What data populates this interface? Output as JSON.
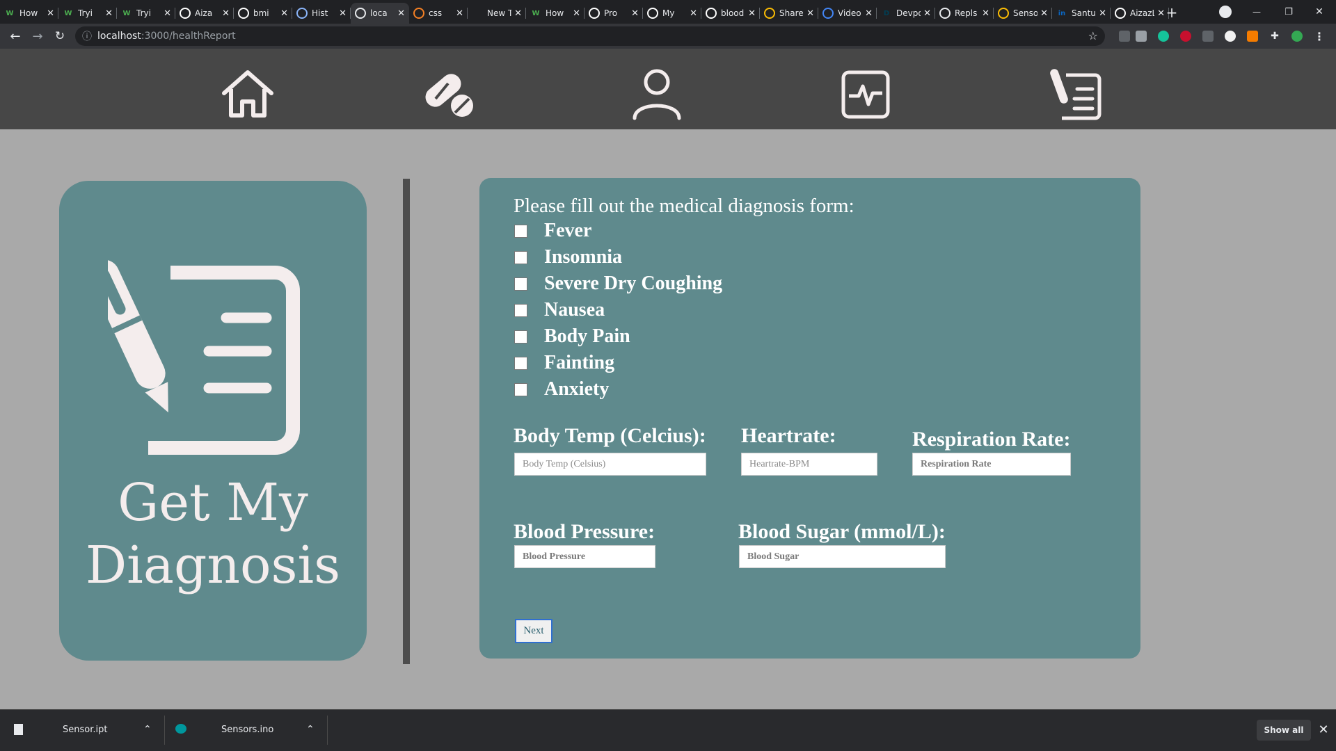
{
  "browser": {
    "tabs": [
      {
        "title": "How",
        "favicon": "W",
        "color": "#4caf50"
      },
      {
        "title": "Tryi",
        "favicon": "W",
        "color": "#4caf50"
      },
      {
        "title": "Tryi",
        "favicon": "W",
        "color": "#4caf50"
      },
      {
        "title": "Aiza",
        "favicon": "github-icon",
        "color": "#ffffff"
      },
      {
        "title": "bmi",
        "favicon": "google-icon",
        "color": "#ffffff"
      },
      {
        "title": "Hist",
        "favicon": "history-icon",
        "color": "#8ab4f8"
      },
      {
        "title": "loca",
        "favicon": "globe-icon",
        "color": "#e8eaed",
        "active": true
      },
      {
        "title": "css",
        "favicon": "stackoverflow-icon",
        "color": "#f48024"
      },
      {
        "title": "New Tab",
        "favicon": "",
        "color": "#e8eaed"
      },
      {
        "title": "How",
        "favicon": "W",
        "color": "#4caf50"
      },
      {
        "title": "Pro",
        "favicon": "github-icon",
        "color": "#ffffff"
      },
      {
        "title": "My",
        "favicon": "wordpress-icon",
        "color": "#ffffff"
      },
      {
        "title": "blood s",
        "favicon": "google-icon",
        "color": "#ffffff"
      },
      {
        "title": "Shared",
        "favicon": "drive-icon",
        "color": "#fbbc04"
      },
      {
        "title": "Video S",
        "favicon": "docs-icon",
        "color": "#4285f4"
      },
      {
        "title": "Devpost",
        "favicon": "D",
        "color": "#003e54"
      },
      {
        "title": "Repls -",
        "favicon": "replit-icon",
        "color": "#e8eaed"
      },
      {
        "title": "Sensor",
        "favicon": "drive-icon",
        "color": "#fbbc04"
      },
      {
        "title": "Santush",
        "favicon": "in",
        "color": "#0a66c2"
      },
      {
        "title": "AizazL/",
        "favicon": "github-icon",
        "color": "#ffffff"
      }
    ],
    "new_tab_label": "+",
    "url_host": "localhost",
    "url_path": ":3000/healthReport",
    "window_controls": {
      "minimize": "—",
      "restore": "❐",
      "close": "✕"
    }
  },
  "app": {
    "nav_icons": [
      "home-icon",
      "pills-icon",
      "user-icon",
      "heart-monitor-icon",
      "report-icon"
    ],
    "card_title_line1": "Get My",
    "card_title_line2": "Diagnosis",
    "form": {
      "heading": "Please fill out the medical diagnosis form:",
      "symptoms": [
        "Fever",
        "Insomnia",
        "Severe Dry Coughing",
        "Nausea",
        "Body Pain",
        "Fainting",
        "Anxiety"
      ],
      "fields": {
        "body_temp": {
          "label": "Body Temp (Celcius):",
          "placeholder": "Body Temp (Celsius)"
        },
        "heartrate": {
          "label": "Heartrate:",
          "placeholder": "Heartrate-BPM"
        },
        "respiration": {
          "label": "Respiration Rate:",
          "placeholder": "Respiration Rate"
        },
        "blood_pressure": {
          "label": "Blood Pressure:",
          "placeholder": "Blood Pressure"
        },
        "blood_sugar": {
          "label": "Blood Sugar (mmol/L):",
          "placeholder": "Blood Sugar"
        }
      },
      "next_label": "Next"
    }
  },
  "downloads": {
    "items": [
      {
        "name": "Sensor.ipt"
      },
      {
        "name": "Sensors.ino"
      }
    ],
    "show_all_label": "Show all"
  },
  "colors": {
    "card": "#5f8a8d",
    "nav_bg": "#474747",
    "page_bg": "#a9a9a9",
    "icon_fill": "#f4eded"
  }
}
